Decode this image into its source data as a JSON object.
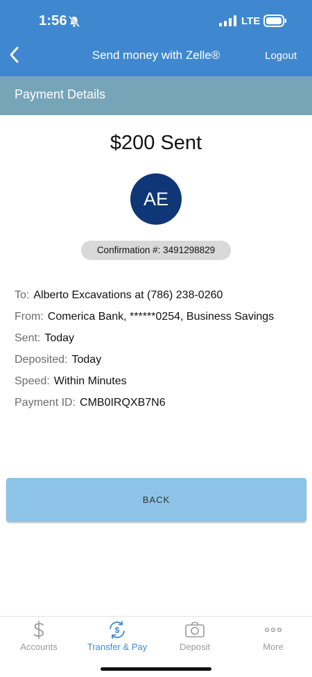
{
  "status_bar": {
    "time": "1:56",
    "network": "LTE"
  },
  "nav": {
    "title": "Send money with Zelle®",
    "logout_label": "Logout"
  },
  "section": {
    "title": "Payment Details"
  },
  "payment": {
    "amount_text": "$200 Sent",
    "avatar_initials": "AE",
    "confirmation": "Confirmation #: 3491298829",
    "details": [
      {
        "key": "To:",
        "value": "Alberto Excavations at (786) 238-0260"
      },
      {
        "key": "From:",
        "value": "Comerica Bank, ******0254, Business Savings"
      },
      {
        "key": "Sent:",
        "value": "Today"
      },
      {
        "key": "Deposited:",
        "value": "Today"
      },
      {
        "key": "Speed:",
        "value": "Within Minutes"
      },
      {
        "key": "Payment ID:",
        "value": "CMB0IRQXB7N6"
      }
    ]
  },
  "actions": {
    "back_label": "BACK"
  },
  "tabbar": {
    "active": "Transfer & Pay",
    "items": [
      {
        "label": "Accounts",
        "icon": "dollar-icon"
      },
      {
        "label": "Transfer & Pay",
        "icon": "transfer-icon"
      },
      {
        "label": "Deposit",
        "icon": "camera-icon"
      },
      {
        "label": "More",
        "icon": "more-dots-icon"
      }
    ]
  },
  "colors": {
    "header_blue": "#3f88cf",
    "section_teal": "#76a5b8",
    "avatar_navy": "#0f3677",
    "button_blue": "#8cc3e6"
  }
}
